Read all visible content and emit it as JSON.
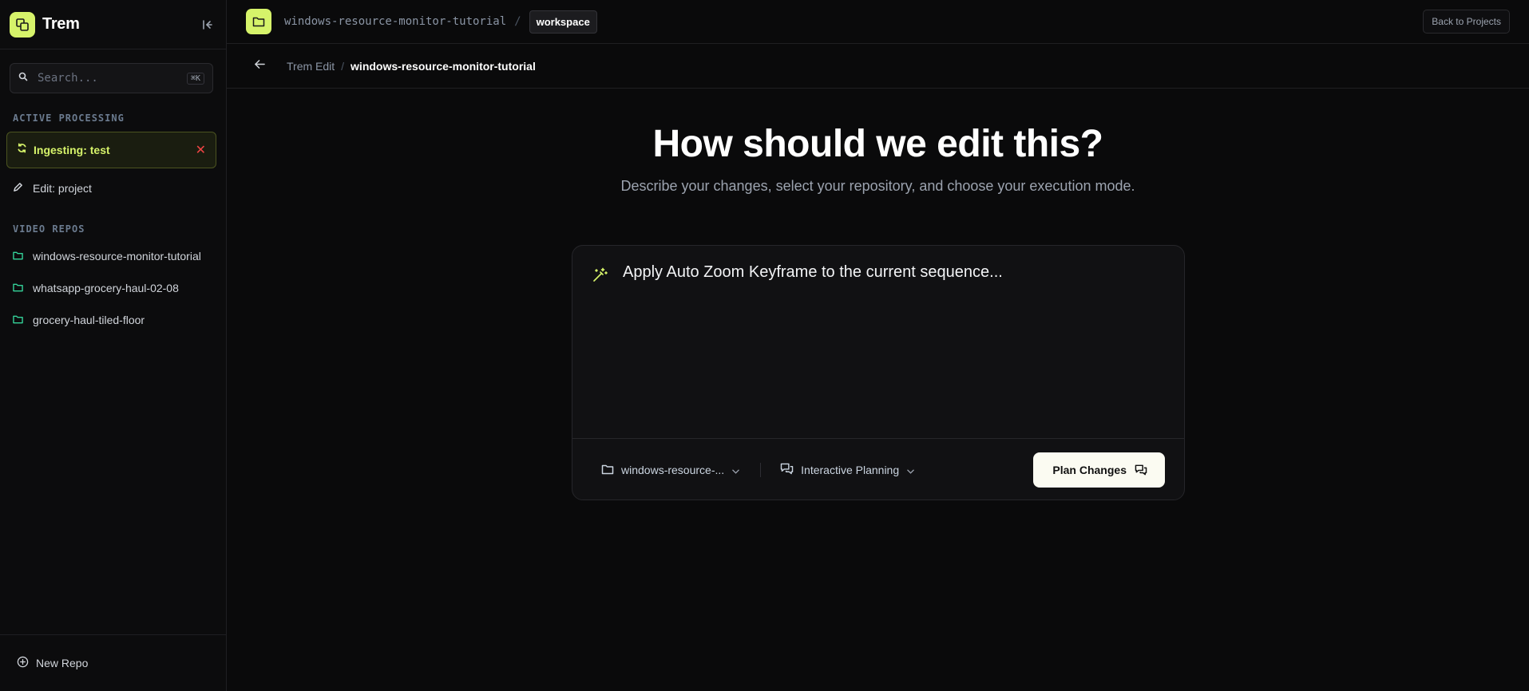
{
  "sidebar": {
    "brand": "Trem",
    "search_placeholder": "Search...",
    "search_shortcut": "⌘K",
    "active_section": "ACTIVE PROCESSING",
    "active_item": "Ingesting: test",
    "edit_item": "Edit: project",
    "repos_section": "VIDEO REPOS",
    "repos": [
      "windows-resource-monitor-tutorial",
      "whatsapp-grocery-haul-02-08",
      "grocery-haul-tiled-floor"
    ],
    "new_repo": "New Repo"
  },
  "topbar": {
    "path": "windows-resource-monitor-tutorial",
    "separator": "/",
    "badge": "workspace",
    "back_button": "Back to Projects"
  },
  "breadcrumb": {
    "parent": "Trem Edit",
    "separator": "/",
    "current": "windows-resource-monitor-tutorial"
  },
  "hero": {
    "title": "How should we edit this?",
    "subtitle": "Describe your changes, select your repository, and choose your execution mode."
  },
  "editor": {
    "prompt_placeholder": "Apply Auto Zoom Keyframe to the current sequence...",
    "repo_select": "windows-resource-...",
    "mode_select": "Interactive Planning",
    "submit_label": "Plan Changes"
  },
  "colors": {
    "accent": "#d6f36a",
    "background": "#0a0a0b",
    "repo_icon": "#34d399",
    "danger": "#ef4444"
  }
}
